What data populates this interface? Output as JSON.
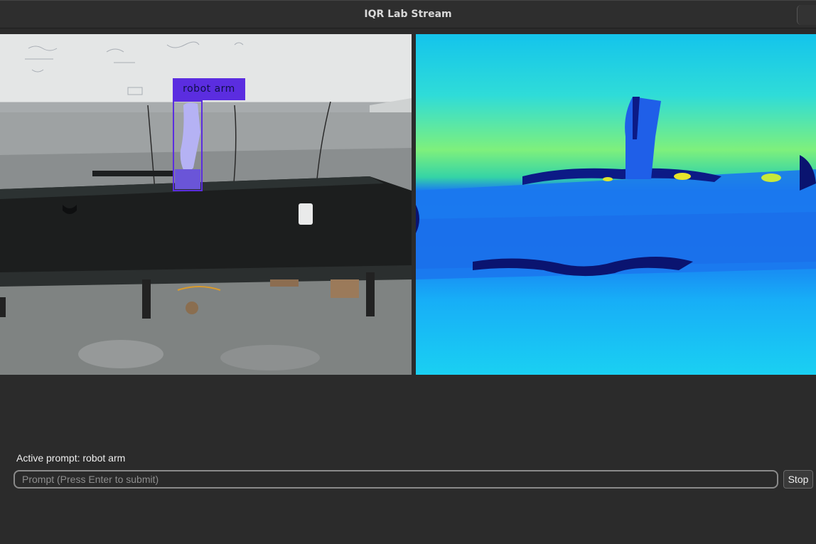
{
  "window": {
    "title": "IQR Lab Stream"
  },
  "rgb_view": {
    "detection": {
      "label": "robot arm",
      "box_color": "#5b2de0"
    }
  },
  "depth_view": {
    "colormap": [
      "#0a0f7a",
      "#1a5cf0",
      "#12b8f5",
      "#2ee0e6",
      "#7cf07a",
      "#e6e82a"
    ]
  },
  "prompt": {
    "status": "Active prompt: robot arm",
    "placeholder": "Prompt (Press Enter to submit)",
    "value": "",
    "stop_label": "Stop"
  }
}
